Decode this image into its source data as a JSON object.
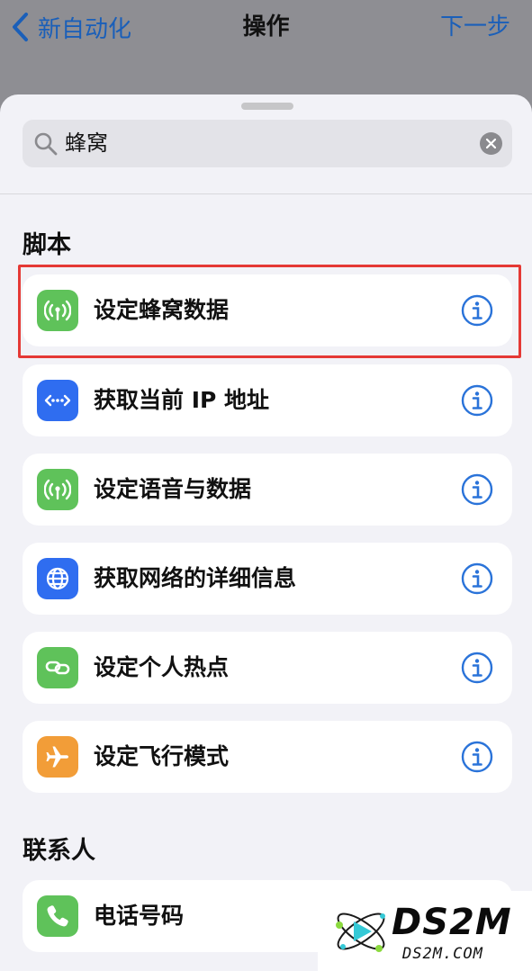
{
  "nav": {
    "back_label": "新自动化",
    "title": "操作",
    "next_label": "下一步"
  },
  "search": {
    "value": "蜂窝",
    "placeholder": "搜索"
  },
  "sections": [
    {
      "header": "脚本",
      "items": [
        {
          "label": "设定蜂窝数据",
          "icon": "cellular-antenna-icon",
          "color": "#5fc25a",
          "highlighted": true
        },
        {
          "label": "获取当前 IP 地址",
          "icon": "ip-dots-icon",
          "color": "#2f6df0"
        },
        {
          "label": "设定语音与数据",
          "icon": "cellular-antenna-icon",
          "color": "#5fc25a"
        },
        {
          "label": "获取网络的详细信息",
          "icon": "globe-icon",
          "color": "#2f6df0"
        },
        {
          "label": "设定个人热点",
          "icon": "chain-link-icon",
          "color": "#5fc25a"
        },
        {
          "label": "设定飞行模式",
          "icon": "airplane-icon",
          "color": "#f29d38"
        }
      ]
    },
    {
      "header": "联系人",
      "items": [
        {
          "label": "电话号码",
          "icon": "phone-icon",
          "color": "#5fc25a"
        }
      ]
    }
  ],
  "watermark": {
    "title": "DS2M",
    "subtitle": "DS2M.COM"
  },
  "colors": {
    "accent": "#1a5fb9",
    "info": "#2a73d9",
    "highlight": "#e53935"
  }
}
